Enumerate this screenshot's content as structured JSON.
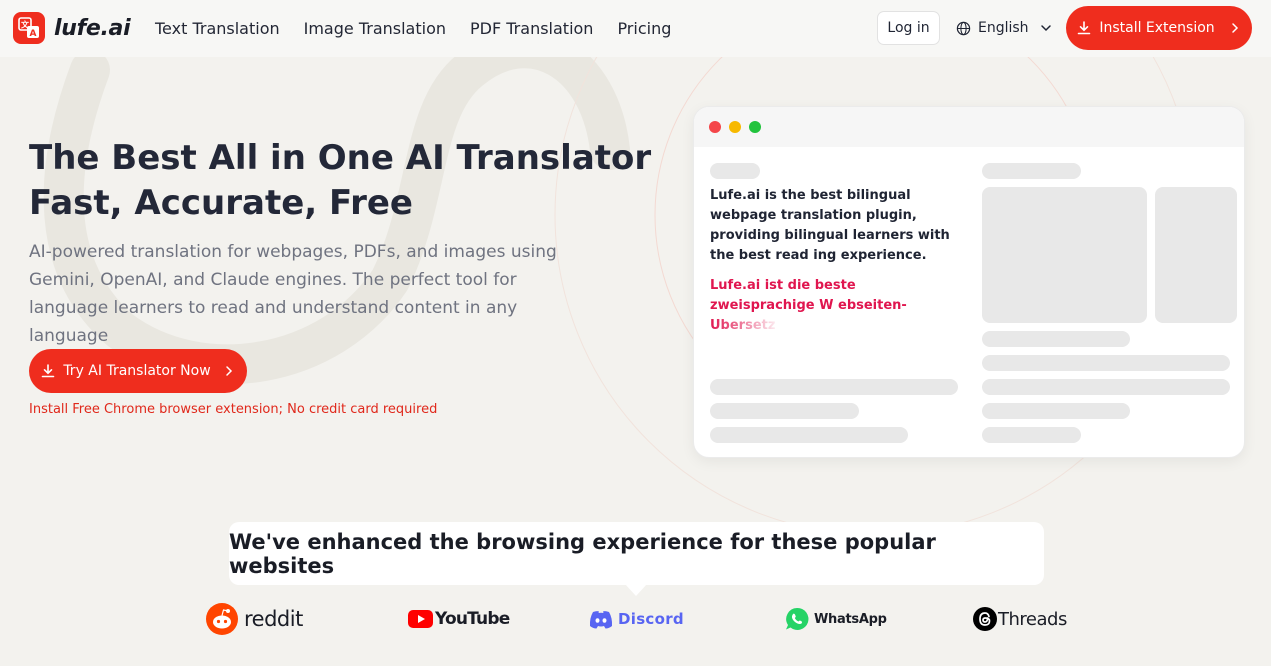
{
  "header": {
    "logo_text": "lufe.ai",
    "nav": [
      "Text Translation",
      "Image Translation",
      "PDF Translation",
      "Pricing"
    ],
    "login_label": "Log in",
    "language_label": "English",
    "install_label": "Install Extension"
  },
  "hero": {
    "title_line1": "The Best All in One AI Translator",
    "title_line2": "Fast, Accurate, Free",
    "subtitle": "AI-powered translation for webpages, PDFs, and images using Gemini, OpenAI, and Claude engines. The perfect tool for language learners to read and understand content in any language",
    "cta_label": "Try AI Translator Now",
    "cta_note": "Install Free Chrome browser extension; No credit card required"
  },
  "mockup": {
    "english_text": "Lufe.ai is the best bilingual webpage translation plugin, providing bilingual learners with the best read ing experience.",
    "german_text": "Lufe.ai ist die beste zweisprachige W ebseiten-",
    "german_fade": "Übersetz"
  },
  "callout_text": "We've enhanced the browsing experience for these popular websites",
  "brands": [
    "reddit",
    "YouTube",
    "Discord",
    "WhatsApp",
    "Threads"
  ],
  "colors": {
    "accent": "#ef2d1e",
    "german_text": "#e0164f",
    "background": "#f3f2ee"
  }
}
